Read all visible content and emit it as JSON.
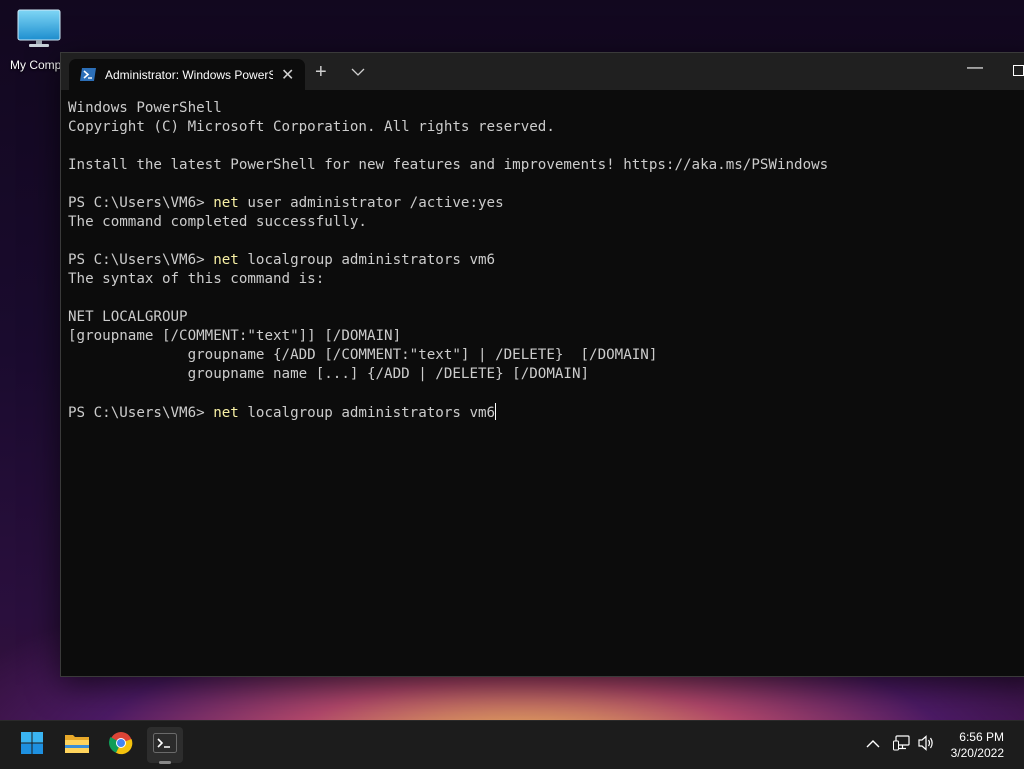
{
  "desktop": {
    "icons": [
      {
        "label": "My Compu",
        "icon": "computer-monitor-icon"
      }
    ]
  },
  "window": {
    "tab_title": "Administrator: Windows PowerS",
    "tab_icon": "powershell-icon",
    "controls": {
      "new_tab": "+",
      "minimize": "—"
    }
  },
  "console": {
    "lines": [
      {
        "text": "Windows PowerShell"
      },
      {
        "text": "Copyright (C) Microsoft Corporation. All rights reserved."
      },
      {
        "text": ""
      },
      {
        "text": "Install the latest PowerShell for new features and improvements! https://aka.ms/PSWindows"
      },
      {
        "text": ""
      },
      {
        "prompt": "PS C:\\Users\\VM6> ",
        "cmd": "net",
        "args": " user administrator /active:yes"
      },
      {
        "text": "The command completed successfully."
      },
      {
        "text": ""
      },
      {
        "prompt": "PS C:\\Users\\VM6> ",
        "cmd": "net",
        "args": " localgroup administrators vm6"
      },
      {
        "text": "The syntax of this command is:"
      },
      {
        "text": ""
      },
      {
        "text": "NET LOCALGROUP"
      },
      {
        "text": "[groupname [/COMMENT:\"text\"]] [/DOMAIN]"
      },
      {
        "text": "              groupname {/ADD [/COMMENT:\"text\"] | /DELETE}  [/DOMAIN]"
      },
      {
        "text": "              groupname name [...] {/ADD | /DELETE} [/DOMAIN]"
      },
      {
        "text": ""
      },
      {
        "prompt": "PS C:\\Users\\VM6> ",
        "cmd": "net",
        "args": " localgroup administrators vm6",
        "cursor": true
      }
    ]
  },
  "taskbar": {
    "items": [
      {
        "name": "start-button",
        "icon": "windows-start-icon"
      },
      {
        "name": "file-explorer-button",
        "icon": "folder-icon"
      },
      {
        "name": "chrome-button",
        "icon": "chrome-icon"
      },
      {
        "name": "terminal-button",
        "icon": "terminal-icon",
        "active": true
      }
    ],
    "tray": {
      "icons": [
        "chevron-up-icon",
        "network-icon",
        "volume-icon"
      ]
    },
    "clock": {
      "time": "6:56 PM",
      "date": "3/20/2022"
    }
  },
  "colors": {
    "console_bg": "#0c0c0c",
    "console_text": "#cccccc",
    "command_highlight": "#f9f1a5",
    "titlebar_bg": "#202020",
    "taskbar_bg": "#1c1c1c"
  }
}
